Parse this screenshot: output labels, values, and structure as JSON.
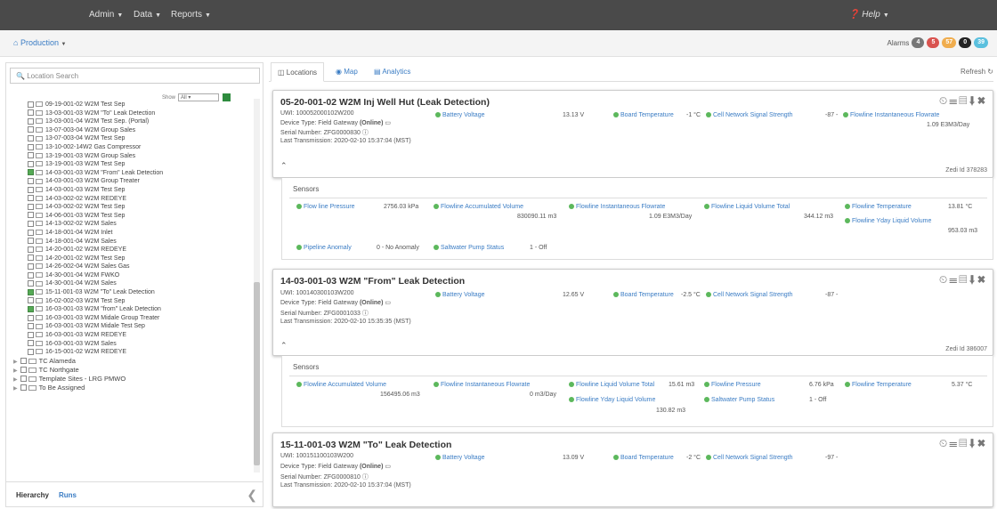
{
  "nav": {
    "menus": [
      "Admin",
      "Data",
      "Reports"
    ],
    "help": "Help"
  },
  "breadcrumb": {
    "label": "Production"
  },
  "alarms": {
    "label": "Alarms",
    "counts": [
      {
        "value": "4",
        "color": "#777777"
      },
      {
        "value": "5",
        "color": "#d9534f"
      },
      {
        "value": "57",
        "color": "#f0ad4e"
      },
      {
        "value": "0",
        "color": "#222222"
      },
      {
        "value": "39",
        "color": "#5bc0de"
      }
    ]
  },
  "left": {
    "search_placeholder": "Location Search",
    "show_label": "Show",
    "show_value": "All",
    "tree_items": [
      {
        "label": "09-19-001-02 W2M Test Sep",
        "checked": false
      },
      {
        "label": "13-03-001-03 W2M \"To\" Leak Detection",
        "checked": false
      },
      {
        "label": "13-03-001-04 W2M Test Sep. (Portal)",
        "checked": false
      },
      {
        "label": "13-07-003-04 W2M Group Sales",
        "checked": false
      },
      {
        "label": "13-07-003-04 W2M Test Sep",
        "checked": false
      },
      {
        "label": "13-10-002-14W2 Gas Compressor",
        "checked": false
      },
      {
        "label": "13-19-001-03 W2M Group Sales",
        "checked": false
      },
      {
        "label": "13-19-001-03 W2M Test Sep",
        "checked": false
      },
      {
        "label": "14-03-001-03 W2M \"From\" Leak Detection",
        "checked": true
      },
      {
        "label": "14-03-001-03 W2M Group Treater",
        "checked": false
      },
      {
        "label": "14-03-001-03 W2M Test Sep",
        "checked": false
      },
      {
        "label": "14-03-002-02 W2M REDEYE",
        "checked": false
      },
      {
        "label": "14-03-002-02 W2M Test Sep",
        "checked": false
      },
      {
        "label": "14-06-001-03 W2M Test Sep",
        "checked": false
      },
      {
        "label": "14-13-002-02 W2M Sales",
        "checked": false
      },
      {
        "label": "14-18-001-04 W2M Inlet",
        "checked": false
      },
      {
        "label": "14-18-001-04 W2M Sales",
        "checked": false
      },
      {
        "label": "14-20-001-02 W2M REDEYE",
        "checked": false
      },
      {
        "label": "14-20-001-02 W2M Test Sep",
        "checked": false
      },
      {
        "label": "14-26-002-04 W2M Sales Gas",
        "checked": false
      },
      {
        "label": "14-30-001-04 W2M FWKO",
        "checked": false
      },
      {
        "label": "14-30-001-04 W2M Sales",
        "checked": false
      },
      {
        "label": "15-11-001-03 W2M \"To\" Leak Detection",
        "checked": true
      },
      {
        "label": "16-02-002-03 W2M Test Sep",
        "checked": false
      },
      {
        "label": "16-03-001-03 W2M \"from\" Leak Detection",
        "checked": true
      },
      {
        "label": "16-03-001-03 W2M Midale Group Treater",
        "checked": false
      },
      {
        "label": "16-03-001-03 W2M Midale Test Sep",
        "checked": false
      },
      {
        "label": "16-03-001-03 W2M REDEYE",
        "checked": false
      },
      {
        "label": "16-03-001-03 W2M Sales",
        "checked": false
      },
      {
        "label": "16-15-001-02 W2M REDEYE",
        "checked": false
      }
    ],
    "groups": [
      "TC Alameda",
      "TC Northgate",
      "Template Sites - LRG PMWO",
      "To Be Assigned"
    ],
    "tab_hierarchy": "Hierarchy",
    "tab_runs": "Runs"
  },
  "right": {
    "tabs": [
      "Locations",
      "Map",
      "Analytics"
    ],
    "refresh": "Refresh"
  },
  "cards": [
    {
      "title": "05-20-001-02 W2M Inj Well Hut (Leak Detection)",
      "uwi": "UWI: 100052000102W200",
      "device_prefix": "Device Type: Field Gateway ",
      "device_status": "(Online)",
      "serial": "Serial Number: ZFG0000830",
      "last_tx": "Last Transmission: 2020-02-10 15:37:04 (MST)",
      "zedi": "Zedi Id 378283",
      "metrics": [
        {
          "label": "Battery Voltage",
          "value": "13.13 V"
        },
        {
          "label": "Board Temperature",
          "value": "-1 °C"
        },
        {
          "label": "Cell Network Signal Strength",
          "value": "-87 -"
        },
        {
          "label": "Flowline Instantaneous Flowrate",
          "value": "1.09 E3M3/Day"
        }
      ],
      "sensors_label": "Sensors",
      "sensors": [
        {
          "label": "Flow line Pressure",
          "value": "2756.03 kPa"
        },
        {
          "label": "Flowline Accumulated Volume",
          "value": "830090.11 m3"
        },
        {
          "label": "Flowline Instantaneous Flowrate",
          "value": "1.09 E3M3/Day"
        },
        {
          "label": "Flowline Liquid Volume Total",
          "value": "344.12 m3"
        },
        {
          "label": "Flowline Temperature",
          "value": "13.81 °C"
        },
        {
          "label": "Flowline Yday Liquid Volume",
          "value": "953.03 m3"
        },
        {
          "label": "Pipeline Anomaly",
          "value": "0 - No Anomaly"
        },
        {
          "label": "Saltwater Pump Status",
          "value": "1 - Off"
        }
      ]
    },
    {
      "title": "14-03-001-03 W2M \"From\" Leak Detection",
      "uwi": "UWI: 100140300103W200",
      "device_prefix": "Device Type: Field Gateway ",
      "device_status": "(Online)",
      "serial": "Serial Number: ZFG0001033",
      "last_tx": "Last Transmission: 2020-02-10 15:35:35 (MST)",
      "zedi": "Zedi Id 386007",
      "metrics": [
        {
          "label": "Battery Voltage",
          "value": "12.65 V"
        },
        {
          "label": "Board Temperature",
          "value": "-2.5 °C"
        },
        {
          "label": "Cell Network Signal Strength",
          "value": "-87 -"
        }
      ],
      "sensors_label": "Sensors",
      "sensors": [
        {
          "label": "Flowline Accumulated Volume",
          "value": "156495.06 m3"
        },
        {
          "label": "Flowline Instantaneous Flowrate",
          "value": "0 m3/Day"
        },
        {
          "label": "Flowline Liquid Volume Total",
          "value": "15.61 m3"
        },
        {
          "label": "Flowline Pressure",
          "value": "6.76 kPa"
        },
        {
          "label": "Flowline Temperature",
          "value": "5.37 °C"
        },
        {
          "label": "Flowline Yday Liquid Volume",
          "value": "130.82 m3"
        },
        {
          "label": "Saltwater Pump Status",
          "value": "1 - Off"
        }
      ]
    },
    {
      "title": "15-11-001-03 W2M \"To\" Leak Detection",
      "uwi": "UWI: 100151100103W200",
      "device_prefix": "Device Type: Field Gateway ",
      "device_status": "(Online)",
      "serial": "Serial Number: ZFG0000810",
      "last_tx": "Last Transmission: 2020-02-10 15:37:04 (MST)",
      "metrics": [
        {
          "label": "Battery Voltage",
          "value": "13.09 V"
        },
        {
          "label": "Board Temperature",
          "value": "-2 °C"
        },
        {
          "label": "Cell Network Signal Strength",
          "value": "-97 -"
        }
      ]
    }
  ]
}
